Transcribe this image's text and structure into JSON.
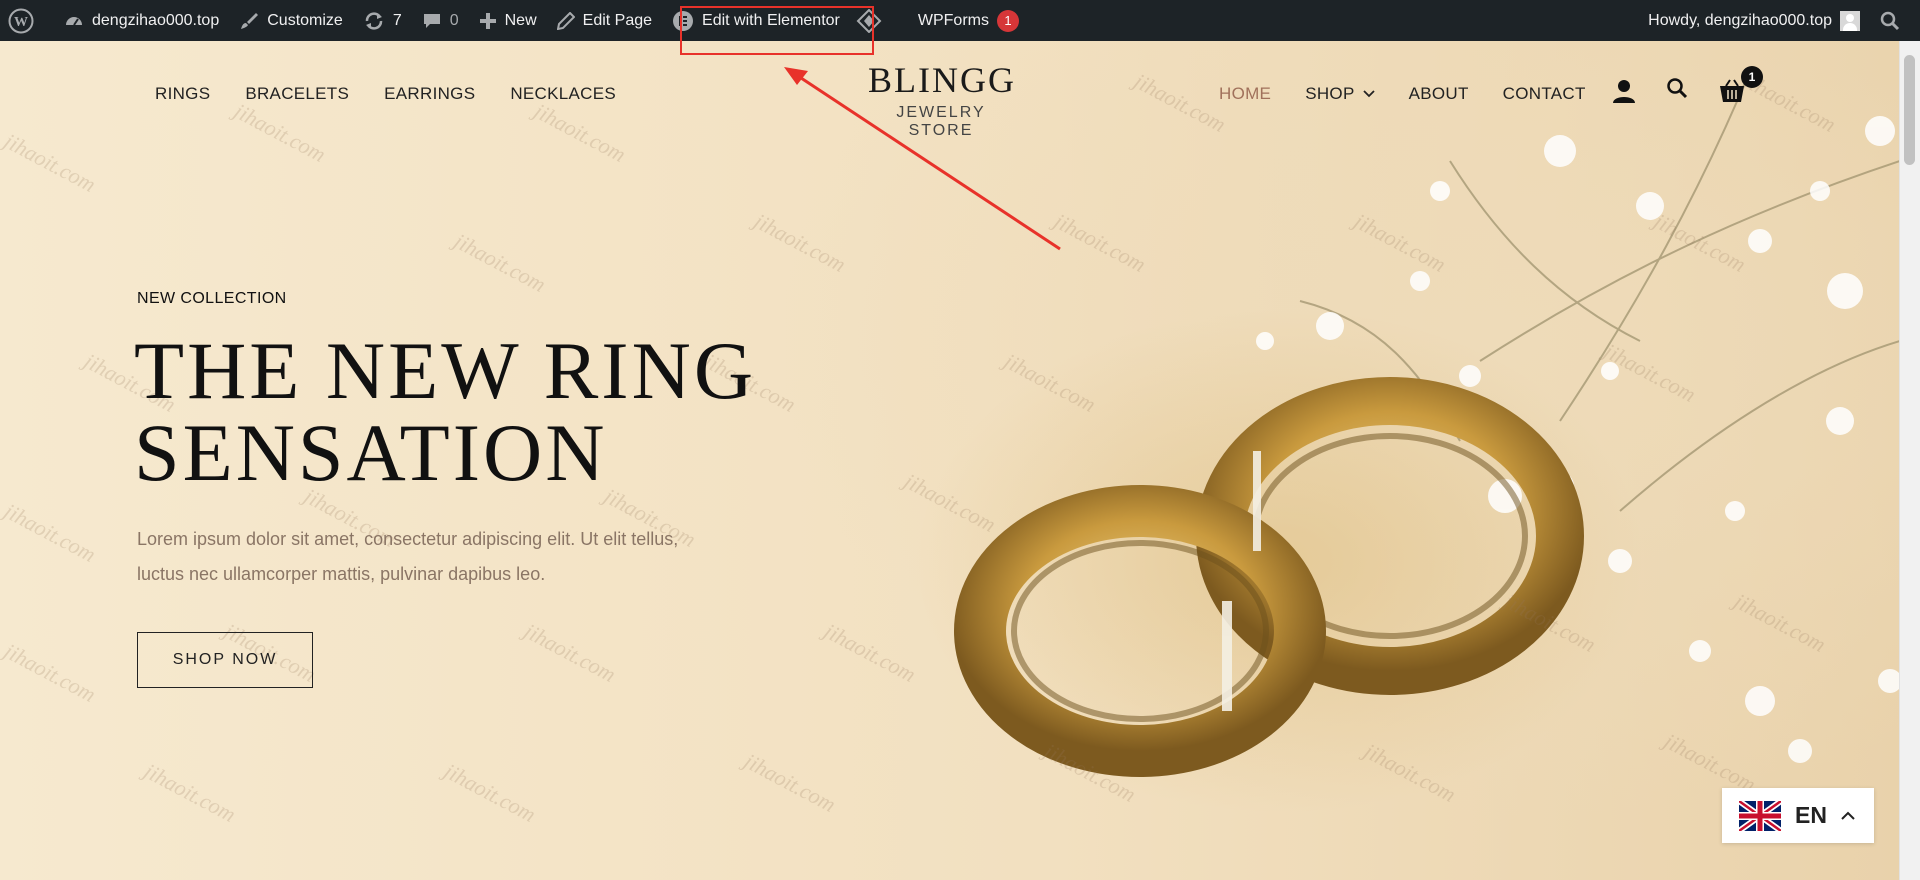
{
  "admin_bar": {
    "site_name": "dengzihao000.top",
    "customize_label": "Customize",
    "updates_count": "7",
    "comments_count": "0",
    "new_label": "New",
    "edit_page_label": "Edit Page",
    "edit_elementor_label": "Edit with Elementor",
    "wpforms_label": "WPForms",
    "wpforms_badge": "1",
    "howdy": "Howdy, dengzihao000.top"
  },
  "nav": {
    "left": [
      "RINGS",
      "BRACELETS",
      "EARRINGS",
      "NECKLACES"
    ],
    "right": [
      "HOME",
      "SHOP",
      "ABOUT",
      "CONTACT"
    ],
    "active": "HOME",
    "cart_count": "1"
  },
  "logo": {
    "main": "BLINGG",
    "sub": "JEWELRY STORE"
  },
  "hero": {
    "kicker": "NEW COLLECTION",
    "headline_line1": "THE NEW RING",
    "headline_line2": "SENSATION",
    "description_line1": "Lorem ipsum dolor sit amet, consectetur adipiscing elit. Ut elit tellus,",
    "description_line2": "luctus nec ullamcorper mattis, pulvinar dapibus leo.",
    "button_label": "SHOP NOW"
  },
  "language": {
    "code": "EN"
  },
  "watermark_text": "jihaoit.com",
  "colors": {
    "admin_bar_bg": "#1d2327",
    "active_nav": "#a0715b",
    "highlight": "#e8322a",
    "badge_red": "#d63638"
  },
  "icons": [
    "wordpress-icon",
    "dashboard-icon",
    "brush-icon",
    "refresh-icon",
    "comment-icon",
    "plus-icon",
    "pencil-icon",
    "elementor-icon",
    "diamond-icon",
    "search-icon",
    "user-icon",
    "cart-icon",
    "chevron-down-icon",
    "chevron-up-icon",
    "uk-flag-icon"
  ]
}
